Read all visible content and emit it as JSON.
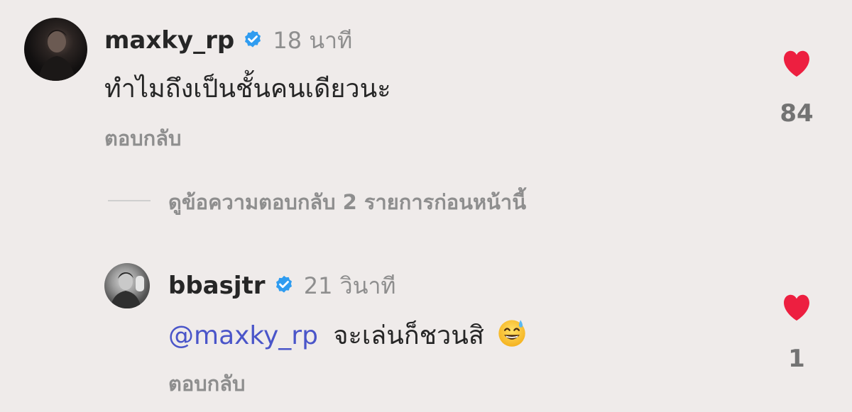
{
  "comment": {
    "username": "maxky_rp",
    "time": "18 นาที",
    "text": "ทำไมถึงเป็นชั้นคนเดียวนะ",
    "reply_label": "ตอบกลับ",
    "likes": "84",
    "verified": true
  },
  "view_replies": {
    "label": "ดูข้อความตอบกลับ 2 รายการก่อนหน้านี้"
  },
  "reply": {
    "username": "bbasjtr",
    "time": "21 วินาที",
    "mention": "@maxky_rp",
    "text": "จะเล่นก็ชวนสิ",
    "emoji": "grinning-face-with-sweat",
    "reply_label": "ตอบกลับ",
    "likes": "1",
    "verified": true
  },
  "colors": {
    "background": "#efebea",
    "heart": "#ed1f40",
    "verified": "#2f9cf0",
    "mention": "#4a55c9",
    "muted": "#8e8e8e"
  }
}
